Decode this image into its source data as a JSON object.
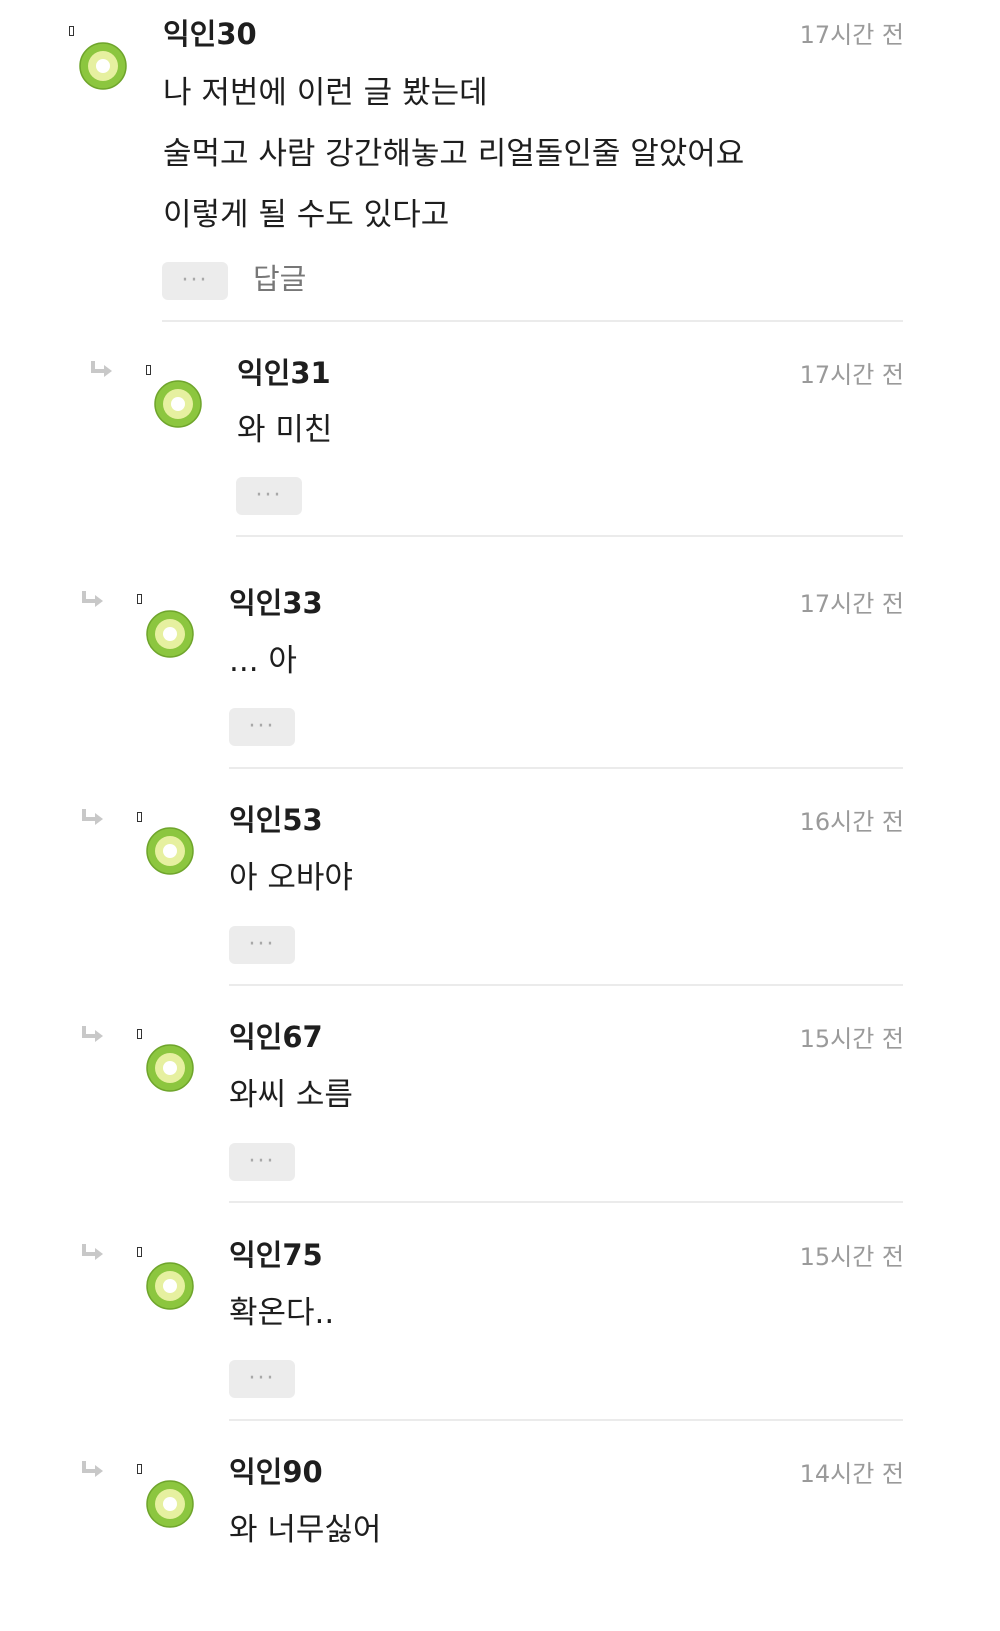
{
  "colors": {
    "avatar_ring": "#8cc63f",
    "avatar_inner": "#e6f0a0",
    "avatar_seed": "#ffffff",
    "timestamp": "#9a9a9a",
    "divider": "#ebebeb",
    "more_button_bg": "#ececec"
  },
  "icons": {
    "reply_indicator": "reply-arrow-icon",
    "avatar": "kiwi-avatar-icon",
    "more": "more-dots-icon"
  },
  "more_label": "···",
  "comments": [
    {
      "name": "익인30",
      "time": "17시간 전",
      "lines": [
        "나 저번에 이런 글 봤는데",
        "술먹고 사람 강간해놓고 리얼돌인줄 알았어요",
        "이렇게 될 수도 있다고"
      ],
      "reply_label": "답글"
    },
    {
      "name": "익인31",
      "time": "17시간 전",
      "lines": [
        "와 미친"
      ]
    },
    {
      "name": "익인33",
      "time": "17시간 전",
      "lines": [
        "... 아"
      ]
    },
    {
      "name": "익인53",
      "time": "16시간 전",
      "lines": [
        "아 오바야"
      ]
    },
    {
      "name": "익인67",
      "time": "15시간 전",
      "lines": [
        "와씨 소름"
      ]
    },
    {
      "name": "익인75",
      "time": "15시간 전",
      "lines": [
        "확온다.."
      ]
    },
    {
      "name": "익인90",
      "time": "14시간 전",
      "lines": [
        "와 너무싫어"
      ]
    }
  ]
}
